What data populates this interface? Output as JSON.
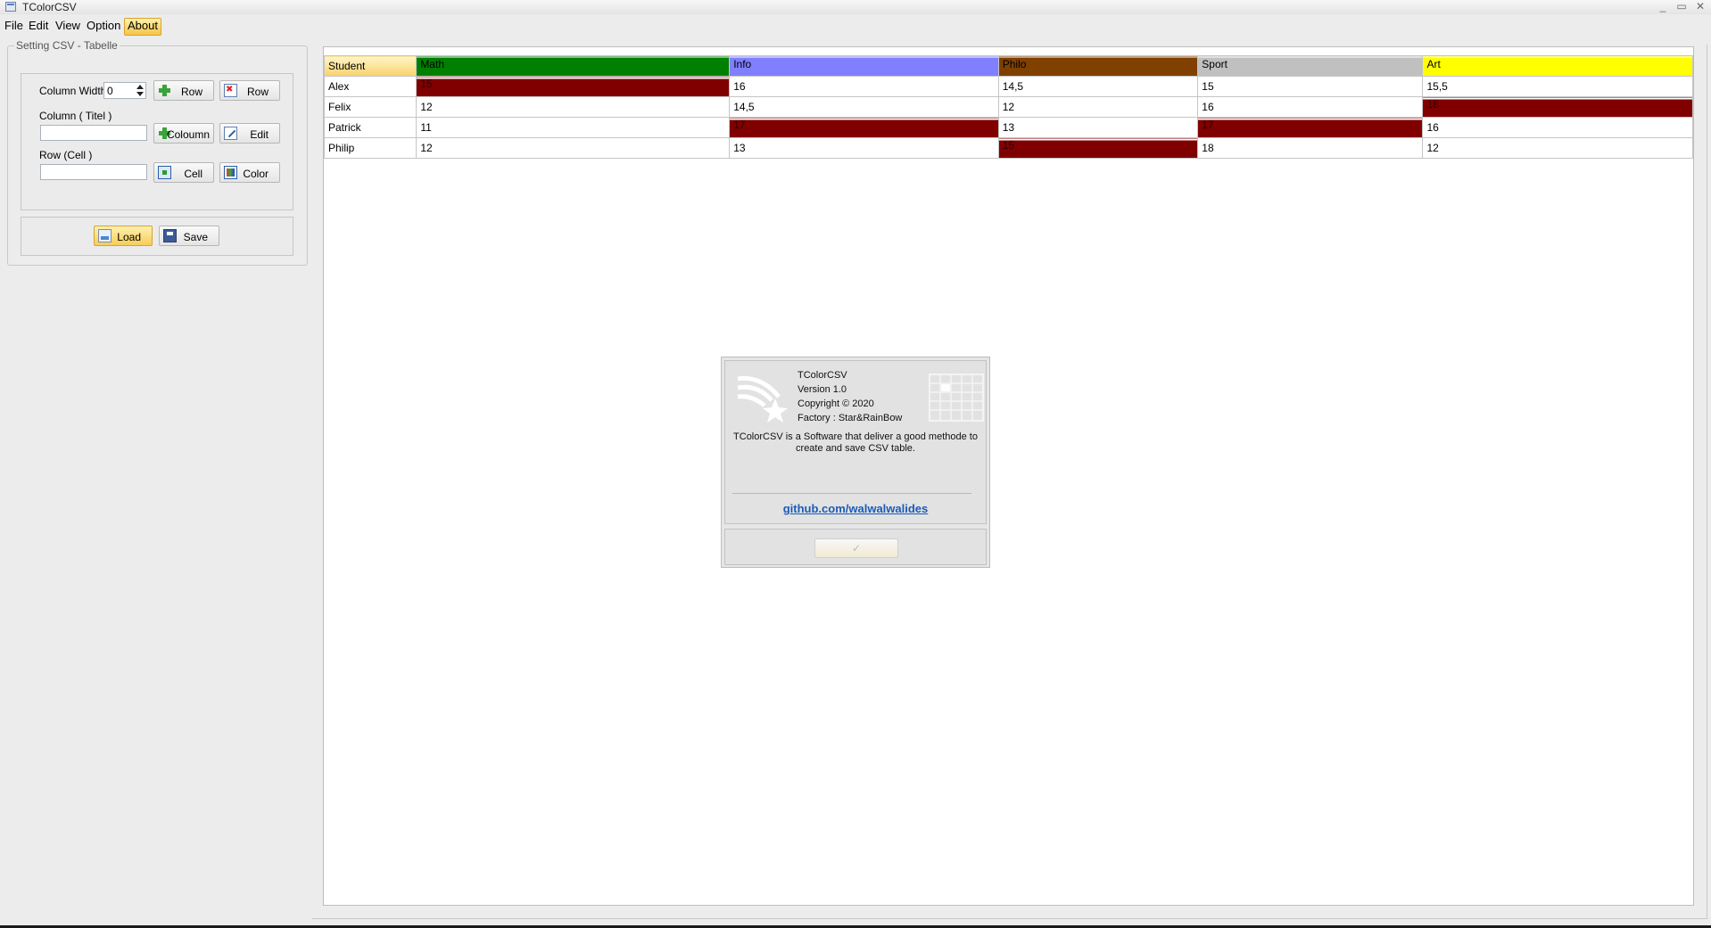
{
  "window": {
    "title": "TColorCSV",
    "controls": [
      "_",
      "▭",
      "✕"
    ]
  },
  "menu": [
    "File",
    "Edit",
    "View",
    "Option",
    "About"
  ],
  "menu_active": "About",
  "settings": {
    "group_title": "Setting CSV - Tabelle",
    "column_width_label": "Column Width",
    "column_width_value": "0",
    "add_row_label": "Row",
    "delete_row_label": "Row",
    "column_title_label": "Column ( Titel )",
    "add_column_label": "Coloumn",
    "edit_label": "Edit",
    "row_cell_label": "Row (Cell )",
    "cell_label": "Cell",
    "color_label": "Color",
    "load_label": "Load",
    "save_label": "Save"
  },
  "table": {
    "headers": [
      {
        "label": "Student",
        "bg": "#f8d26b"
      },
      {
        "label": "Math",
        "bg": "#008000"
      },
      {
        "label": "Info",
        "bg": "#8080ff"
      },
      {
        "label": "Philo",
        "bg": "#804000"
      },
      {
        "label": "Sport",
        "bg": "#c0c0c0"
      },
      {
        "label": "Art",
        "bg": "#ffff00"
      }
    ],
    "rows": [
      {
        "name": "Alex",
        "cells": [
          {
            "v": "15",
            "hl": true
          },
          {
            "v": "16"
          },
          {
            "v": "14,5"
          },
          {
            "v": "15"
          },
          {
            "v": "15,5"
          }
        ]
      },
      {
        "name": "Felix",
        "cells": [
          {
            "v": "12"
          },
          {
            "v": "14,5"
          },
          {
            "v": "12"
          },
          {
            "v": "16"
          },
          {
            "v": "18",
            "hl": true
          }
        ]
      },
      {
        "name": "Patrick",
        "cells": [
          {
            "v": "11"
          },
          {
            "v": "17",
            "hl": true
          },
          {
            "v": "13"
          },
          {
            "v": "17",
            "hl": true
          },
          {
            "v": "16"
          }
        ]
      },
      {
        "name": "Philip",
        "cells": [
          {
            "v": "12"
          },
          {
            "v": "13"
          },
          {
            "v": "15",
            "hl": true
          },
          {
            "v": "18"
          },
          {
            "v": "12"
          }
        ]
      }
    ],
    "highlight_color": "#800000"
  },
  "about_dialog": {
    "app_name": "TColorCSV",
    "version": "Version 1.0",
    "copyright": "Copyright © 2020",
    "factory": "Factory : Star&RainBow",
    "description_1": "TColorCSV is a Software that deliver a good methode to",
    "description_2": "create and save CSV table.",
    "link": "github.com/walwalwalides"
  }
}
